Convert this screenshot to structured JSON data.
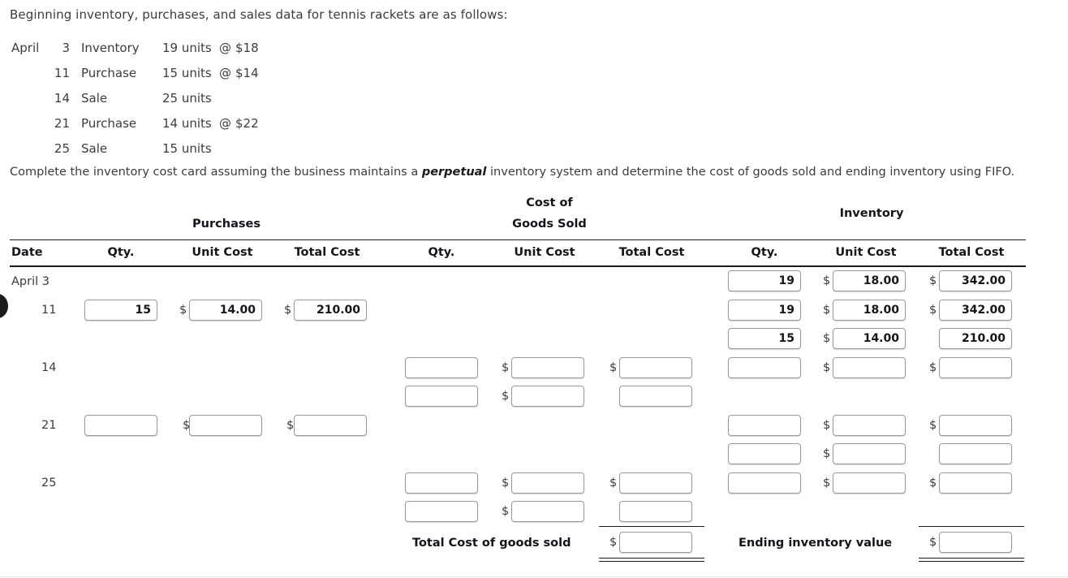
{
  "intro": {
    "text": "Beginning inventory, purchases, and sales data for tennis rackets are as follows:"
  },
  "data_lines": [
    {
      "month": "April",
      "day": "3",
      "desc": "Inventory",
      "units": "19 units",
      "at": "@",
      "price": "$18"
    },
    {
      "month": "",
      "day": "11",
      "desc": "Purchase",
      "units": "15 units",
      "at": "@",
      "price": "$14"
    },
    {
      "month": "",
      "day": "14",
      "desc": "Sale",
      "units": "25 units",
      "at": "",
      "price": ""
    },
    {
      "month": "",
      "day": "21",
      "desc": "Purchase",
      "units": "14 units",
      "at": "@",
      "price": "$22"
    },
    {
      "month": "",
      "day": "25",
      "desc": "Sale",
      "units": "15 units",
      "at": "",
      "price": ""
    }
  ],
  "instruction": {
    "before": "Complete the inventory cost card assuming the business maintains a ",
    "emphasis": "perpetual",
    "after": " inventory system and determine the cost of goods sold and ending inventory using FIFO."
  },
  "table": {
    "group_headers": {
      "purchases": "Purchases",
      "cogs_line1": "Cost of",
      "cogs_line2": "Goods Sold",
      "inventory": "Inventory"
    },
    "column_headers": {
      "date": "Date",
      "purch_qty": "Qty.",
      "purch_unit": "Unit Cost",
      "purch_total": "Total Cost",
      "cogs_qty": "Qty.",
      "cogs_unit": "Unit Cost",
      "cogs_total": "Total Cost",
      "inv_qty": "Qty.",
      "inv_unit": "Unit Cost",
      "inv_total": "Total Cost"
    },
    "row_labels": {
      "r1": "April  3",
      "r2": "11",
      "r3": "14",
      "r4": "21",
      "r5": "25"
    },
    "dollar_sign": "$",
    "cells": {
      "apr3_inv_qty": "19",
      "apr3_inv_unit": "18.00",
      "apr3_inv_total": "342.00",
      "apr11_purch_qty": "15",
      "apr11_purch_unit": "14.00",
      "apr11_purch_total": "210.00",
      "apr11_inv_qty_a": "19",
      "apr11_inv_unit_a": "18.00",
      "apr11_inv_total_a": "342.00",
      "apr11_inv_qty_b": "15",
      "apr11_inv_unit_b": "14.00",
      "apr11_inv_total_b": "210.00",
      "apr14_cogs_qty_a": "",
      "apr14_cogs_unit_a": "",
      "apr14_cogs_total_a": "",
      "apr14_cogs_qty_b": "",
      "apr14_cogs_unit_b": "",
      "apr14_cogs_total_b": "",
      "apr14_inv_qty": "",
      "apr14_inv_unit": "",
      "apr14_inv_total": "",
      "apr21_purch_qty": "",
      "apr21_purch_unit": "",
      "apr21_purch_total": "",
      "apr21_inv_qty_a": "",
      "apr21_inv_unit_a": "",
      "apr21_inv_total_a": "",
      "apr21_inv_qty_b": "",
      "apr21_inv_unit_b": "",
      "apr21_inv_total_b": "",
      "apr25_cogs_qty_a": "",
      "apr25_cogs_unit_a": "",
      "apr25_cogs_total_a": "",
      "apr25_cogs_qty_b": "",
      "apr25_cogs_unit_b": "",
      "apr25_cogs_total_b": "",
      "apr25_inv_qty": "",
      "apr25_inv_unit": "",
      "apr25_inv_total": "",
      "total_cogs": "",
      "ending_inventory": ""
    },
    "totals": {
      "cogs_label": "Total Cost of goods sold",
      "ending_label": "Ending inventory value"
    }
  }
}
